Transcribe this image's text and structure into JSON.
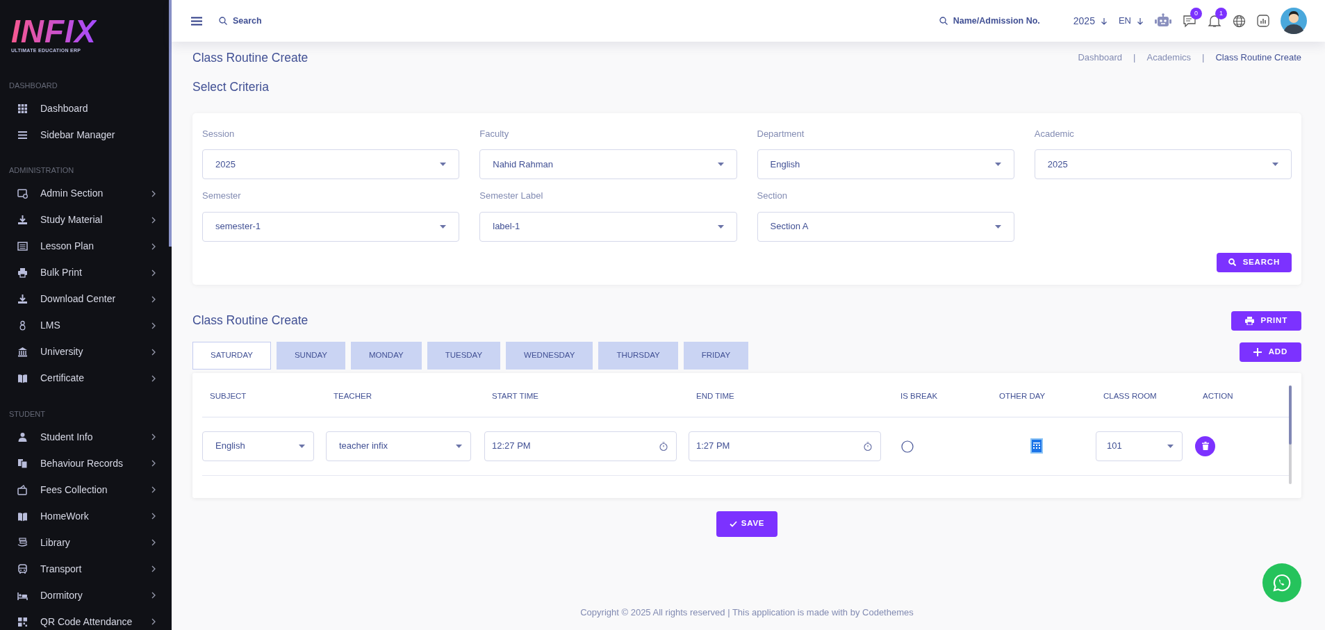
{
  "brand": {
    "logo": "INFIX",
    "tagline": "ULTIMATE EDUCATION ERP"
  },
  "sidebar": {
    "sections": [
      {
        "title": "DASHBOARD",
        "items": [
          {
            "label": "Dashboard",
            "has_submenu": false
          },
          {
            "label": "Sidebar Manager",
            "has_submenu": false
          }
        ]
      },
      {
        "title": "ADMINISTRATION",
        "items": [
          {
            "label": "Admin Section",
            "has_submenu": true
          },
          {
            "label": "Study Material",
            "has_submenu": true
          },
          {
            "label": "Lesson Plan",
            "has_submenu": true
          },
          {
            "label": "Bulk Print",
            "has_submenu": true
          },
          {
            "label": "Download Center",
            "has_submenu": true
          },
          {
            "label": "LMS",
            "has_submenu": true
          },
          {
            "label": "University",
            "has_submenu": true
          },
          {
            "label": "Certificate",
            "has_submenu": true
          }
        ]
      },
      {
        "title": "STUDENT",
        "items": [
          {
            "label": "Student Info",
            "has_submenu": true
          },
          {
            "label": "Behaviour Records",
            "has_submenu": true
          },
          {
            "label": "Fees Collection",
            "has_submenu": true
          },
          {
            "label": "HomeWork",
            "has_submenu": true
          },
          {
            "label": "Library",
            "has_submenu": true
          },
          {
            "label": "Transport",
            "has_submenu": true
          },
          {
            "label": "Dormitory",
            "has_submenu": true
          },
          {
            "label": "QR Code Attendance",
            "has_submenu": true
          }
        ]
      }
    ]
  },
  "topbar": {
    "search": "Search",
    "student_search": "Name/Admission No.",
    "year": "2025",
    "language": "EN",
    "messages_badge": "0",
    "notifications_badge": "1"
  },
  "page_title": "Class Routine Create",
  "breadcrumb": [
    "Dashboard",
    "Academics",
    "Class Routine Create"
  ],
  "breadcrumb_separators": [
    "|",
    "|"
  ],
  "criteria": {
    "title": "Select Criteria",
    "fields": [
      {
        "label": "Session",
        "value": "2025"
      },
      {
        "label": "Faculty",
        "value": "Nahid Rahman"
      },
      {
        "label": "Department",
        "value": "English"
      },
      {
        "label": "Academic",
        "value": "2025"
      },
      {
        "label": "Semester",
        "value": "semester-1"
      },
      {
        "label": "Semester Label",
        "value": "label-1"
      },
      {
        "label": "Section",
        "value": "Section A"
      }
    ],
    "search_button": "SEARCH"
  },
  "routine": {
    "title": "Class Routine Create",
    "print_button": "PRINT",
    "add_button": "ADD",
    "tabs": [
      {
        "label": "SATURDAY",
        "selected": true
      },
      {
        "label": "SUNDAY",
        "selected": false
      },
      {
        "label": "MONDAY",
        "selected": false
      },
      {
        "label": "TUESDAY",
        "selected": false
      },
      {
        "label": "WEDNESDAY",
        "selected": false
      },
      {
        "label": "THURSDAY",
        "selected": false
      },
      {
        "label": "FRIDAY",
        "selected": false
      }
    ],
    "columns": [
      "SUBJECT",
      "TEACHER",
      "START TIME",
      "END TIME",
      "IS BREAK",
      "OTHER DAY",
      "CLASS ROOM",
      "ACTION"
    ],
    "rows": [
      {
        "subject": "English",
        "teacher": "teacher infix",
        "start_time": "12:27 PM",
        "end_time": "1:27 PM",
        "is_break": false,
        "class_room": "101"
      }
    ],
    "save_button": "SAVE"
  },
  "footer": "Copyright © 2025 All rights reserved | This application is made with by Codethemes"
}
